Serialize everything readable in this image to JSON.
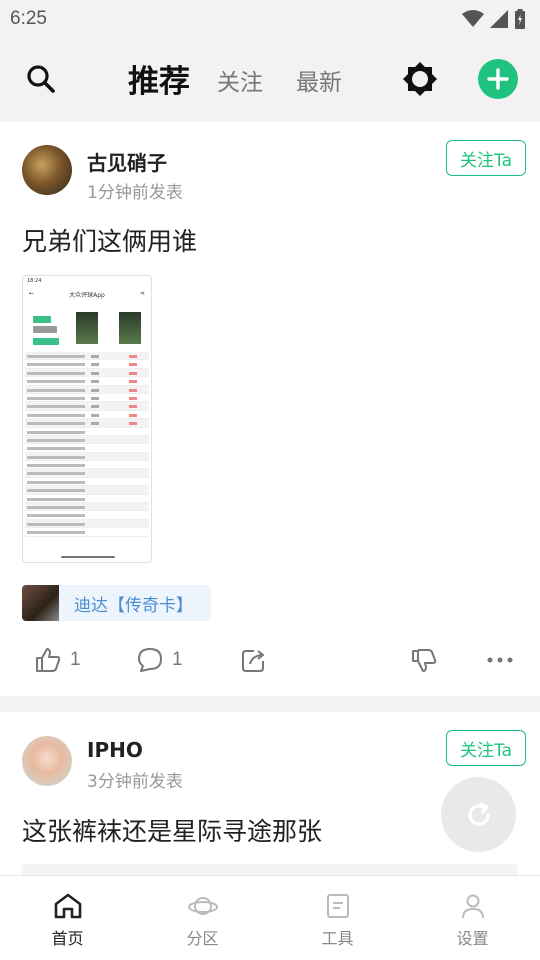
{
  "status_bar": {
    "time": "6:25"
  },
  "top_nav": {
    "tabs": [
      {
        "label": "推荐",
        "active": true
      },
      {
        "label": "关注",
        "active": false
      },
      {
        "label": "最新",
        "active": false
      }
    ],
    "accent_color": "#1fc37f"
  },
  "posts": [
    {
      "username": "古见硝子",
      "time": "1分钟前发表",
      "follow_label": "关注Ta",
      "text": "兄弟们这俩用谁",
      "image": {
        "status_time": "18:24",
        "app_title": "大众评球App"
      },
      "tag": {
        "label": "迪达【传奇卡】"
      },
      "likes": "1",
      "comments": "1"
    },
    {
      "username": "IPHO",
      "time": "3分钟前发表",
      "follow_label": "关注Ta",
      "text": "这张裤袜还是星际寻途那张"
    }
  ],
  "bottom_nav": [
    {
      "label": "首页",
      "icon": "home-icon",
      "active": true
    },
    {
      "label": "分区",
      "icon": "planet-icon",
      "active": false
    },
    {
      "label": "工具",
      "icon": "tools-icon",
      "active": false
    },
    {
      "label": "设置",
      "icon": "person-icon",
      "active": false
    }
  ]
}
